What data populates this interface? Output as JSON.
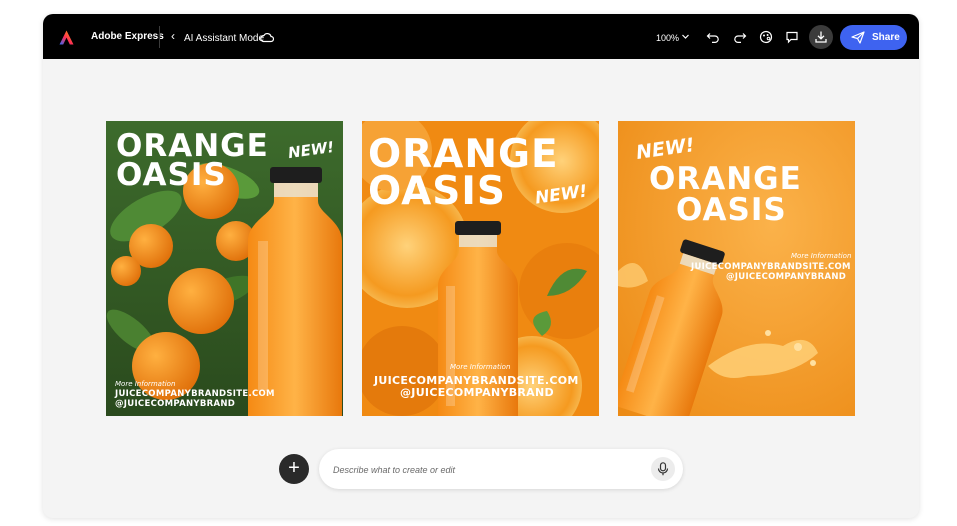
{
  "app": {
    "name": "Adobe Express",
    "mode_label": "AI Assistant Mode"
  },
  "toolbar": {
    "zoom": "100%",
    "icons": [
      "undo-icon",
      "redo-icon",
      "brand-kit-icon",
      "comment-icon",
      "download-icon",
      "send-icon"
    ],
    "share_label": "Share",
    "accent": "#3e63f0"
  },
  "designs": [
    {
      "title_line1": "ORANGE",
      "title_line2": "OASIS",
      "new_tag": "NEW!",
      "more_info": "More Information",
      "site": "JUICECOMPANYBRANDSITE.COM",
      "handle": "@JUICECOMPANYBRAND"
    },
    {
      "title_line1": "ORANGE",
      "title_line2": "OASIS",
      "new_tag": "NEW!",
      "more_info": "More Information",
      "site": "JUICECOMPANYBRANDSITE.COM",
      "handle": "@JUICECOMPANYBRAND"
    },
    {
      "title_line1": "ORANGE",
      "title_line2": "OASIS",
      "new_tag": "NEW!",
      "more_info": "More Information",
      "site": "JUICECOMPANYBRANDSITE.COM",
      "handle": "@JUICECOMPANYBRAND"
    }
  ],
  "prompt": {
    "placeholder": "Describe what to create or edit",
    "add_icon": "plus-icon",
    "mic_icon": "microphone-icon"
  },
  "colors": {
    "topbar": "#000000",
    "canvas": "#f4f4f4",
    "orange": "#f39216"
  }
}
